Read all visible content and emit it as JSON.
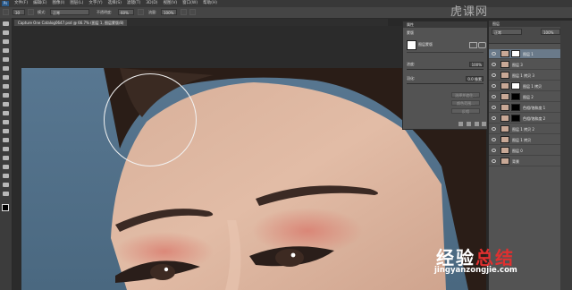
{
  "menu": {
    "logo": "Ps",
    "items": [
      "文件(F)",
      "编辑(E)",
      "图像(I)",
      "图层(L)",
      "文字(Y)",
      "选择(S)",
      "滤镜(T)",
      "3D(D)",
      "视图(V)",
      "窗口(W)",
      "帮助(H)"
    ]
  },
  "options": {
    "brush_size": "30",
    "mode_label": "模式:",
    "mode_value": "正常",
    "opacity_label": "不透明度:",
    "opacity_value": "60%",
    "flow_label": "流量:",
    "flow_value": "100%"
  },
  "document_tab": "Capture One Catalog0647.psd @ 66.7% (图层 1, 图层蒙版/8)",
  "properties": {
    "title": "属性",
    "subtitle": "蒙版",
    "mask_label": "图层蒙版",
    "density_label": "浓度:",
    "density_value": "100%",
    "feather_label": "羽化:",
    "feather_value": "0.0 像素",
    "buttons": [
      "选择并遮住...",
      "颜色范围...",
      "反相"
    ]
  },
  "layers": {
    "title": "图层",
    "mode": "正常",
    "opacity": "100%",
    "items": [
      {
        "name": "图层 1",
        "selected": true,
        "mask": "white"
      },
      {
        "name": "图层 3",
        "selected": false,
        "mask": ""
      },
      {
        "name": "图层 1 拷贝 3",
        "selected": false,
        "mask": ""
      },
      {
        "name": "图层 1 拷贝",
        "selected": false,
        "mask": "white"
      },
      {
        "name": "图层 2",
        "selected": false,
        "mask": "black"
      },
      {
        "name": "色相/饱和度 1",
        "selected": false,
        "mask": "black"
      },
      {
        "name": "色相/饱和度 2",
        "selected": false,
        "mask": "black"
      },
      {
        "name": "图层 1 拷贝 2",
        "selected": false,
        "mask": ""
      },
      {
        "name": "图层 1 拷贝",
        "selected": false,
        "mask": ""
      },
      {
        "name": "图层 0",
        "selected": false,
        "mask": ""
      },
      {
        "name": "背景",
        "selected": false,
        "mask": ""
      }
    ]
  },
  "watermark": {
    "top_right": "虎课网",
    "title_part1": "经验",
    "title_part2": "总结",
    "url": "jingyanzongjie.com"
  }
}
